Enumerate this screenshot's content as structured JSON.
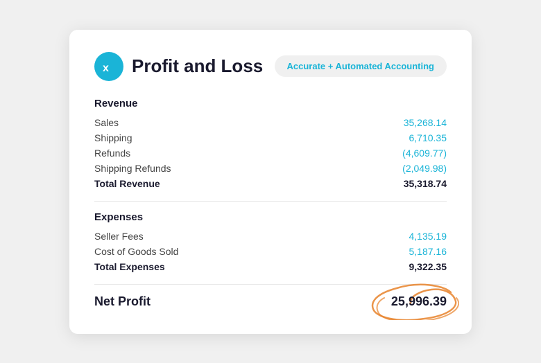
{
  "header": {
    "title": "Profit and Loss",
    "badge": "Accurate + Automated Accounting",
    "logo_alt": "Xero"
  },
  "revenue": {
    "section_title": "Revenue",
    "items": [
      {
        "label": "Sales",
        "value": "35,268.14",
        "negative": false
      },
      {
        "label": "Shipping",
        "value": "6,710.35",
        "negative": false
      },
      {
        "label": "Refunds",
        "value": "(4,609.77)",
        "negative": true
      },
      {
        "label": "Shipping Refunds",
        "value": "(2,049.98)",
        "negative": true
      }
    ],
    "total_label": "Total Revenue",
    "total_value": "35,318.74"
  },
  "expenses": {
    "section_title": "Expenses",
    "items": [
      {
        "label": "Seller Fees",
        "value": "4,135.19",
        "negative": false
      },
      {
        "label": "Cost of Goods Sold",
        "value": "5,187.16",
        "negative": false
      }
    ],
    "total_label": "Total Expenses",
    "total_value": "9,322.35"
  },
  "net_profit": {
    "label": "Net Profit",
    "value": "25,996.39"
  }
}
